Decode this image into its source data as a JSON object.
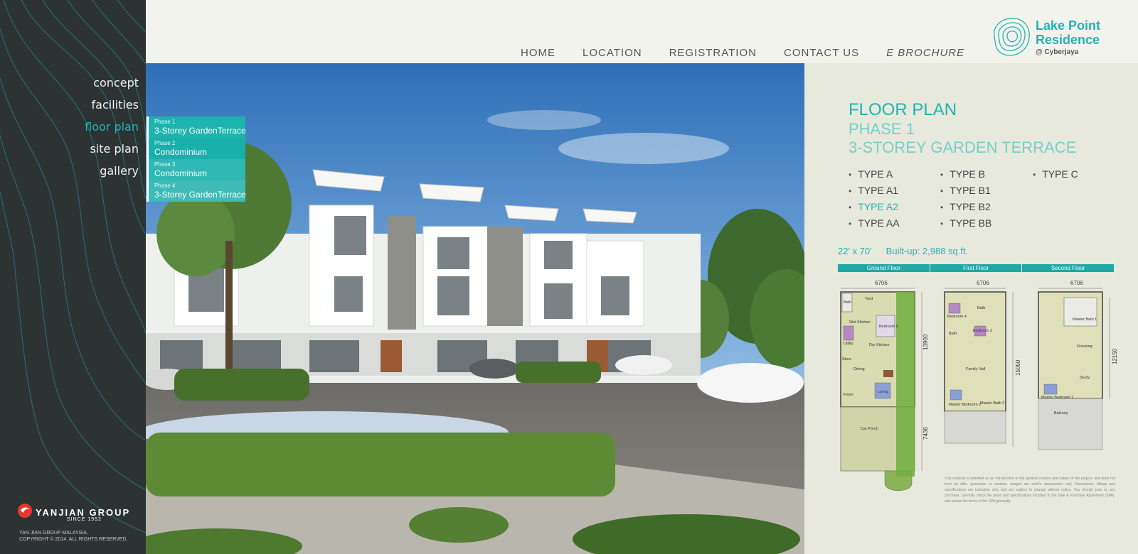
{
  "sidebar": {
    "nav": [
      {
        "label": "concept",
        "active": false
      },
      {
        "label": "facilities",
        "active": false
      },
      {
        "label": "floor plan",
        "active": true
      },
      {
        "label": "site plan",
        "active": false
      },
      {
        "label": "gallery",
        "active": false
      }
    ],
    "logo": {
      "name": "YANJIAN GROUP",
      "since": "SINCE 1952"
    },
    "copyright_line1": "YAN JIAN GROUP MALAYSIA.",
    "copyright_line2": "COPYRIGHT © 2014. ALL RIGHTS RESERVED."
  },
  "top_nav": [
    "HOME",
    "LOCATION",
    "REGISTRATION",
    "CONTACT US",
    "E BROCHURE"
  ],
  "brand": {
    "line1": "Lake Point",
    "line2": "Residence",
    "line3": "@ Cyberjaya"
  },
  "phase_menu": [
    {
      "phase": "Phase 1",
      "name": "3-Storey GardenTerrace",
      "color": "#1fb3ae"
    },
    {
      "phase": "Phase 2",
      "name": "Condominium",
      "color": "#19b0ac"
    },
    {
      "phase": "Phase 3",
      "name": "Condominium",
      "color": "#2fb8b4"
    },
    {
      "phase": "Phase 4",
      "name": "3-Storey GardenTerrace",
      "color": "#3ebbb6"
    }
  ],
  "panel": {
    "title": "FLOOR PLAN",
    "phase": "PHASE 1",
    "type": "3-STOREY GARDEN TERRACE",
    "types_col1": [
      "TYPE A",
      "TYPE A1",
      "TYPE A2",
      "TYPE AA"
    ],
    "types_col2": [
      "TYPE B",
      "TYPE B1",
      "TYPE B2",
      "TYPE BB"
    ],
    "types_col3": [
      "TYPE C"
    ],
    "active_type": "TYPE A2",
    "size": "22' x 70'",
    "builtup": "Built-up: 2,988 sq.ft.",
    "floors": [
      "Ground Floor",
      "First Floor",
      "Second Floor"
    ],
    "dims": {
      "ground_width": "6706",
      "ground_depth": "13900",
      "porch_depth": "7436",
      "first_width": "6706",
      "first_depth": "15050",
      "second_width": "6706",
      "second_depth": "12150"
    },
    "rooms_ground": [
      "Yard",
      "Bath",
      "Wet Kitchen",
      "Bedroom 5",
      "Utility",
      "Dry Kitchen",
      "Store",
      "Dining",
      "Foyer",
      "Living",
      "Car Porch"
    ],
    "rooms_first": [
      "Bedroom 4",
      "Bath",
      "Bath",
      "Bedroom 3",
      "Family Hall",
      "Master Bedroom 2",
      "Master Bath 2"
    ],
    "rooms_second": [
      "Master Bath 1",
      "Dressing",
      "Study",
      "Master Bedroom 1",
      "Balcony"
    ],
    "disclaimer": "This material is intended as an introduction to the general content and nature of the project, and does not form an offer, guarantee or contract. Images are artist's impressions only. Dimensions, fittings and specifications are indicative only and are subject to change without notice. You should, prior to any purchase, carefully check the plans and specifications included in the Sale & Purchase Agreement (SPA), and review the terms of the SPA generally."
  },
  "colors": {
    "accent": "#22b3b0",
    "sidebar": "#2d3233",
    "panel": "#e7e9dd"
  }
}
